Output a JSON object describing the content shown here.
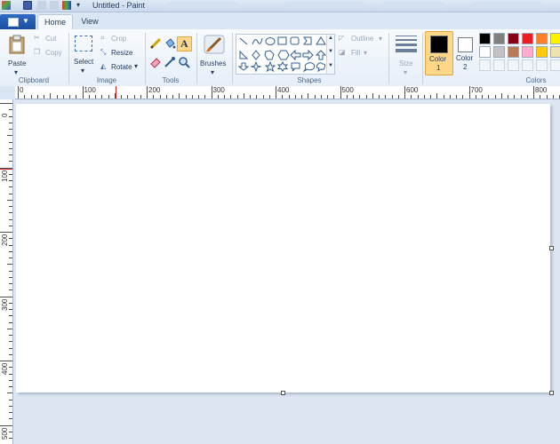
{
  "window": {
    "title": "Untitled - Paint"
  },
  "tabs": {
    "home": "Home",
    "view": "View"
  },
  "clipboard": {
    "paste": "Paste",
    "cut": "Cut",
    "copy": "Copy",
    "group": "Clipboard"
  },
  "image": {
    "select": "Select",
    "crop": "Crop",
    "resize": "Resize",
    "rotate": "Rotate",
    "group": "Image"
  },
  "tools": {
    "group": "Tools"
  },
  "brushes": {
    "label": "Brushes"
  },
  "shapes": {
    "outline": "Outline",
    "fill": "Fill",
    "group": "Shapes"
  },
  "size": {
    "label": "Size"
  },
  "colors": {
    "color1_line1": "Color",
    "color1_line2": "1",
    "color2_line1": "Color",
    "color2_line2": "2",
    "group": "Colors",
    "color1": "#000000",
    "color2": "#ffffff",
    "palette_row1": [
      "#000000",
      "#7f7f7f",
      "#880015",
      "#ed1c24",
      "#ff7f27",
      "#fff200"
    ],
    "palette_row2": [
      "#ffffff",
      "#c3c3c3",
      "#b97a57",
      "#ffaec9",
      "#ffc90e",
      "#efe4b0"
    ]
  },
  "ruler": {
    "h_labels": [
      "0",
      "100",
      "200",
      "300",
      "400",
      "500",
      "600",
      "700",
      "800"
    ],
    "v_labels": [
      "0",
      "100",
      "200",
      "300",
      "400",
      "500"
    ]
  }
}
